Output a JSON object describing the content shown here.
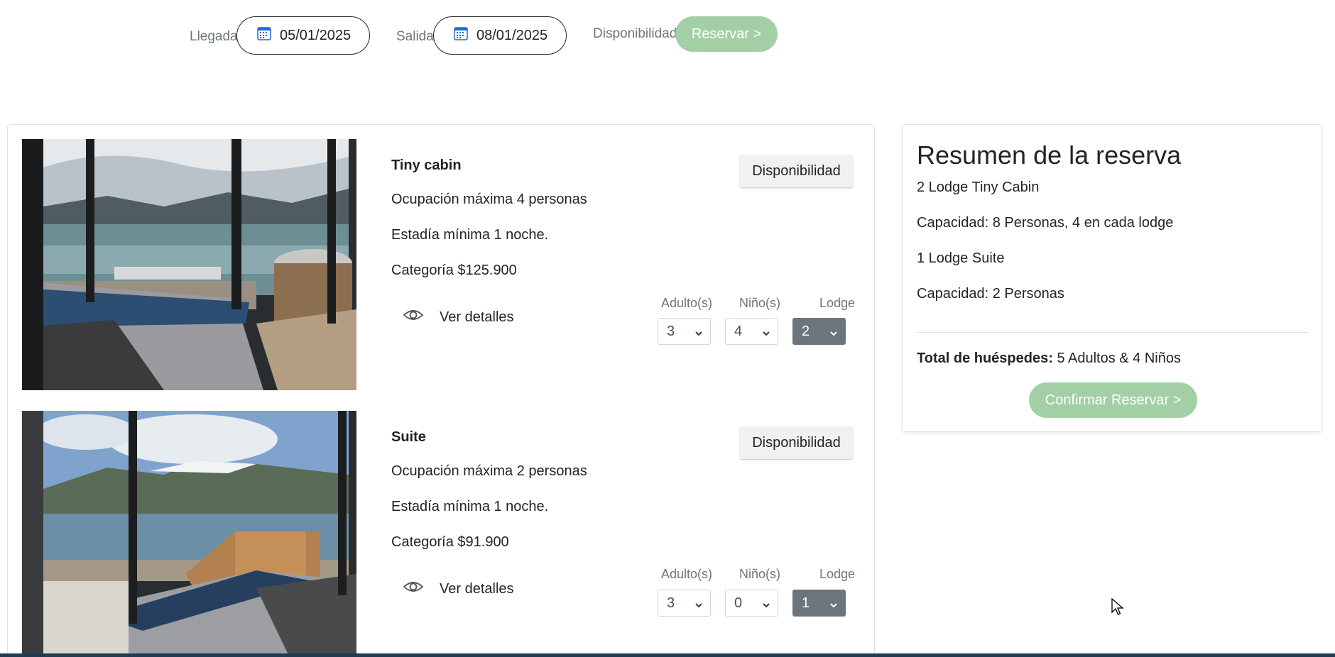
{
  "search": {
    "arrival_label": "Llegada",
    "arrival_value": "05/01/2025",
    "departure_label": "Salida",
    "departure_value": "08/01/2025",
    "availability_label": "Disponibilidad",
    "reserve_button": "Reservar >"
  },
  "rooms": [
    {
      "name": "Tiny cabin",
      "occupancy": "Ocupación máxima 4 personas",
      "min_stay": "Estadía mínima 1 noche.",
      "category": "Categoría $125.900",
      "availability_button": "Disponibilidad",
      "details_link": "Ver detalles",
      "adults_label": "Adulto(s)",
      "children_label": "Niño(s)",
      "lodge_label": "Lodge",
      "adults_value": "3",
      "children_value": "4",
      "lodge_value": "2"
    },
    {
      "name": "Suite",
      "occupancy": "Ocupación máxima 2 personas",
      "min_stay": "Estadía mínima 1 noche.",
      "category": "Categoría $91.900",
      "availability_button": "Disponibilidad",
      "details_link": "Ver detalles",
      "adults_label": "Adulto(s)",
      "children_label": "Niño(s)",
      "lodge_label": "Lodge",
      "adults_value": "3",
      "children_value": "0",
      "lodge_value": "1"
    }
  ],
  "summary": {
    "title": "Resumen de la reserva",
    "lines": [
      "2 Lodge Tiny Cabin",
      "Capacidad: 8 Personas, 4 en cada lodge",
      "1 Lodge Suite",
      "Capacidad: 2 Personas"
    ],
    "total_label": "Total de huéspedes:",
    "total_value": " 5 Adultos & 4 Niños",
    "confirm_button": "Confirmar Reservar >"
  },
  "colors": {
    "accent_green": "#a3cfa5",
    "select_dark": "#6c757d",
    "bottom_bar": "#1d3d57"
  }
}
